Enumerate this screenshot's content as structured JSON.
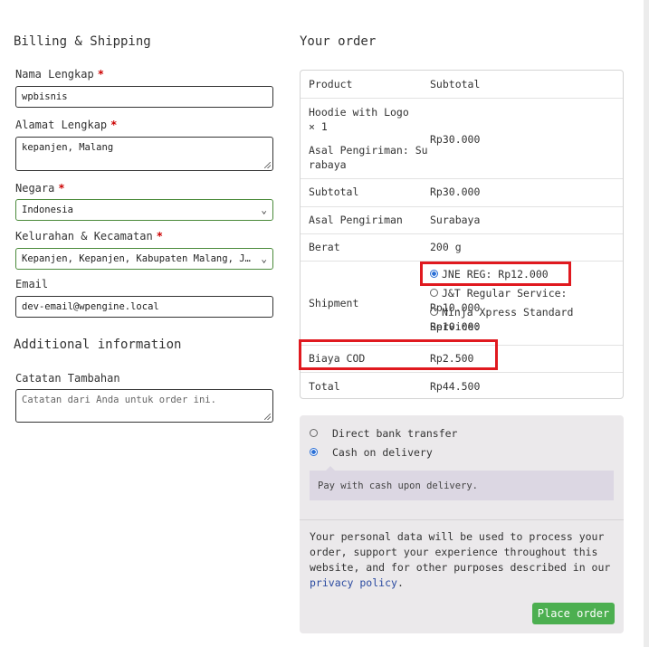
{
  "billing": {
    "heading": "Billing & Shipping",
    "name_label": "Nama Lengkap",
    "name_value": "wpbisnis",
    "address_label": "Alamat Lengkap",
    "address_value": "kepanjen, Malang",
    "country_label": "Negara",
    "country_value": "Indonesia",
    "district_label": "Kelurahan & Kecamatan",
    "district_value": "Kepanjen, Kepanjen, Kabupaten Malang, Jawa Timur",
    "email_label": "Email",
    "email_value": "dev-email@wpengine.local",
    "required_mark": "*"
  },
  "additional": {
    "heading": "Additional information",
    "notes_label": "Catatan Tambahan",
    "notes_placeholder": "Catatan dari Anda untuk order ini."
  },
  "order": {
    "heading": "Your order",
    "col_product": "Product",
    "col_subtotal": "Subtotal",
    "item_name": "Hoodie with Logo",
    "item_qty": "× 1",
    "item_origin_line1": "Asal Pengiriman: Su",
    "item_origin_line2": "rabaya",
    "item_price": "Rp30.000",
    "subtotal_label": "Subtotal",
    "subtotal_value": "Rp30.000",
    "origin_label": "Asal Pengiriman",
    "origin_value": "Surabaya",
    "weight_label": "Berat",
    "weight_value": "200 g",
    "shipment_label": "Shipment",
    "shipment_options": [
      {
        "label": "JNE REG: Rp12.000",
        "selected": true
      },
      {
        "label": "J&T Regular Service: Rp10.000",
        "selected": false
      },
      {
        "label": "Ninja Xpress Standard Service:",
        "selected": false
      }
    ],
    "shipment_option3_line2": "Rp10.000",
    "cod_label": "Biaya COD",
    "cod_value": "Rp2.500",
    "total_label": "Total",
    "total_value": "Rp44.500"
  },
  "payment": {
    "methods": [
      {
        "label": "Direct bank transfer",
        "selected": false
      },
      {
        "label": "Cash on delivery",
        "selected": true
      }
    ],
    "cod_description": "Pay with cash upon delivery.",
    "privacy_line1": "Your personal data will be used to process your",
    "privacy_line2": "order, support your experience throughout this",
    "privacy_line3": "website, and for other purposes described in our",
    "privacy_link": "privacy policy",
    "privacy_end": ".",
    "place_order": "Place order"
  },
  "colors": {
    "accent_button": "#4caf50",
    "highlight_box": "#e0191f",
    "selected_radio": "#2a6fd6"
  }
}
